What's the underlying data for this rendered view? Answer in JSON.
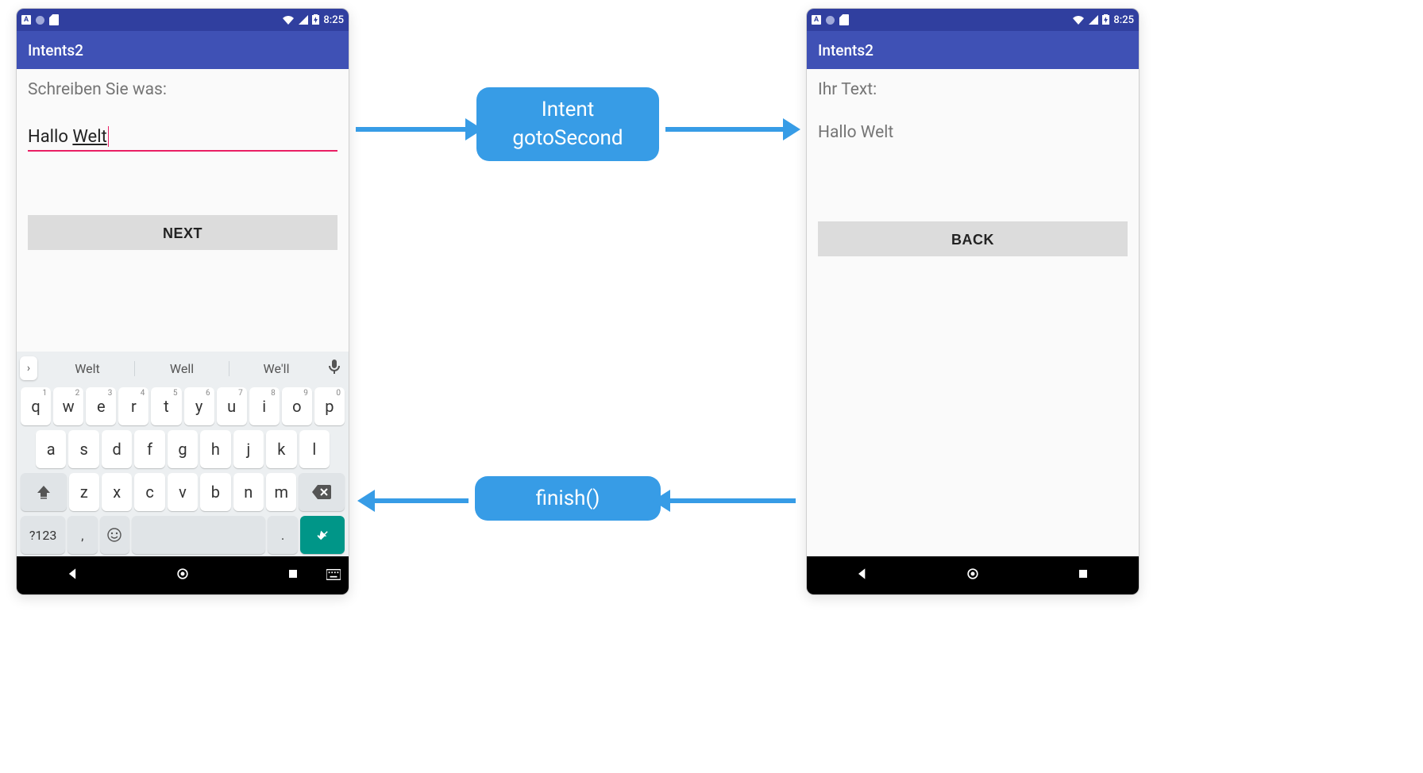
{
  "app_title": "Intents2",
  "status_time": "8:25",
  "screen1": {
    "prompt": "Schreiben Sie was:",
    "input_plain": "Hallo ",
    "input_underlined": "Welt",
    "next_label": "NEXT"
  },
  "screen2": {
    "label": "Ihr Text:",
    "value": "Hallo Welt",
    "back_label": "BACK"
  },
  "flow": {
    "intent_line1": "Intent",
    "intent_line2": "gotoSecond",
    "finish": "finish()"
  },
  "keyboard": {
    "suggestions": [
      "Welt",
      "Well",
      "We'll"
    ],
    "row1": [
      {
        "c": "q",
        "d": "1"
      },
      {
        "c": "w",
        "d": "2"
      },
      {
        "c": "e",
        "d": "3"
      },
      {
        "c": "r",
        "d": "4"
      },
      {
        "c": "t",
        "d": "5"
      },
      {
        "c": "y",
        "d": "6"
      },
      {
        "c": "u",
        "d": "7"
      },
      {
        "c": "i",
        "d": "8"
      },
      {
        "c": "o",
        "d": "9"
      },
      {
        "c": "p",
        "d": "0"
      }
    ],
    "row2": [
      "a",
      "s",
      "d",
      "f",
      "g",
      "h",
      "j",
      "k",
      "l"
    ],
    "row3": [
      "z",
      "x",
      "c",
      "v",
      "b",
      "n",
      "m"
    ],
    "sym": "?123",
    "comma": ",",
    "period": "."
  }
}
